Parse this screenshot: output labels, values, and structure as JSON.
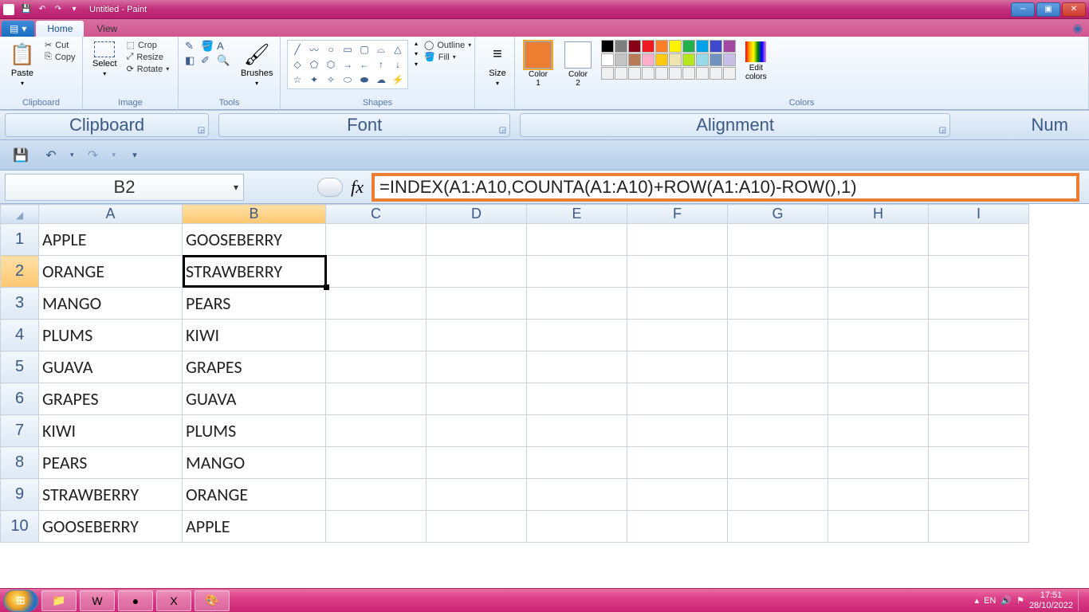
{
  "title": "Untitled - Paint",
  "window_controls": {
    "min": "─",
    "max": "▣",
    "close": "✕"
  },
  "ribbon": {
    "file_label": "",
    "tabs": {
      "home": "Home",
      "view": "View"
    },
    "clipboard": {
      "paste": "Paste",
      "cut": "Cut",
      "copy": "Copy",
      "label": "Clipboard"
    },
    "image": {
      "select": "Select",
      "crop": "Crop",
      "resize": "Resize",
      "rotate": "Rotate",
      "label": "Image"
    },
    "tools": {
      "brushes": "Brushes",
      "label": "Tools"
    },
    "shapes": {
      "outline": "Outline",
      "fill": "Fill",
      "label": "Shapes"
    },
    "size": {
      "label_btn": "Size"
    },
    "colors": {
      "c1": "Color\n1",
      "c2": "Color\n2",
      "edit": "Edit\ncolors",
      "label": "Colors"
    }
  },
  "excel_ribbon": {
    "clipboard": "Clipboard",
    "font": "Font",
    "alignment": "Alignment",
    "num": "Num"
  },
  "formula": {
    "cell_ref": "B2",
    "fx": "fx",
    "text": "=INDEX(A1:A10,COUNTA(A1:A10)+ROW(A1:A10)-ROW(),1)"
  },
  "columns": [
    "A",
    "B",
    "C",
    "D",
    "E",
    "F",
    "G",
    "H",
    "I"
  ],
  "rows": [
    {
      "n": "1",
      "a": "APPLE",
      "b": "GOOSEBERRY"
    },
    {
      "n": "2",
      "a": "ORANGE",
      "b": "STRAWBERRY"
    },
    {
      "n": "3",
      "a": "MANGO",
      "b": "PEARS"
    },
    {
      "n": "4",
      "a": "PLUMS",
      "b": "KIWI"
    },
    {
      "n": "5",
      "a": "GUAVA",
      "b": "GRAPES"
    },
    {
      "n": "6",
      "a": "GRAPES",
      "b": "GUAVA"
    },
    {
      "n": "7",
      "a": "KIWI",
      "b": "PLUMS"
    },
    {
      "n": "8",
      "a": "PEARS",
      "b": "MANGO"
    },
    {
      "n": "9",
      "a": "STRAWBERRY",
      "b": "ORANGE"
    },
    {
      "n": "10",
      "a": "GOOSEBERRY",
      "b": "APPLE"
    }
  ],
  "status": {
    "lang": "EN",
    "time": "17:51",
    "date": "28/10/2022"
  },
  "palette": {
    "primary": "#ed7d31",
    "row1": [
      "#000",
      "#7f7f7f",
      "#880015",
      "#ed1c24",
      "#ff7f27",
      "#fff200",
      "#22b14c",
      "#00a2e8",
      "#3f48cc",
      "#a349a4"
    ],
    "row2": [
      "#fff",
      "#c3c3c3",
      "#b97a57",
      "#ffaec9",
      "#ffc90e",
      "#efe4b0",
      "#b5e61d",
      "#99d9ea",
      "#7092be",
      "#c8bfe7"
    ],
    "row3": [
      "#f0f0f0",
      "#f0f0f0",
      "#f0f0f0",
      "#f0f0f0",
      "#f0f0f0",
      "#f0f0f0",
      "#f0f0f0",
      "#f0f0f0",
      "#f0f0f0",
      "#f0f0f0"
    ]
  }
}
